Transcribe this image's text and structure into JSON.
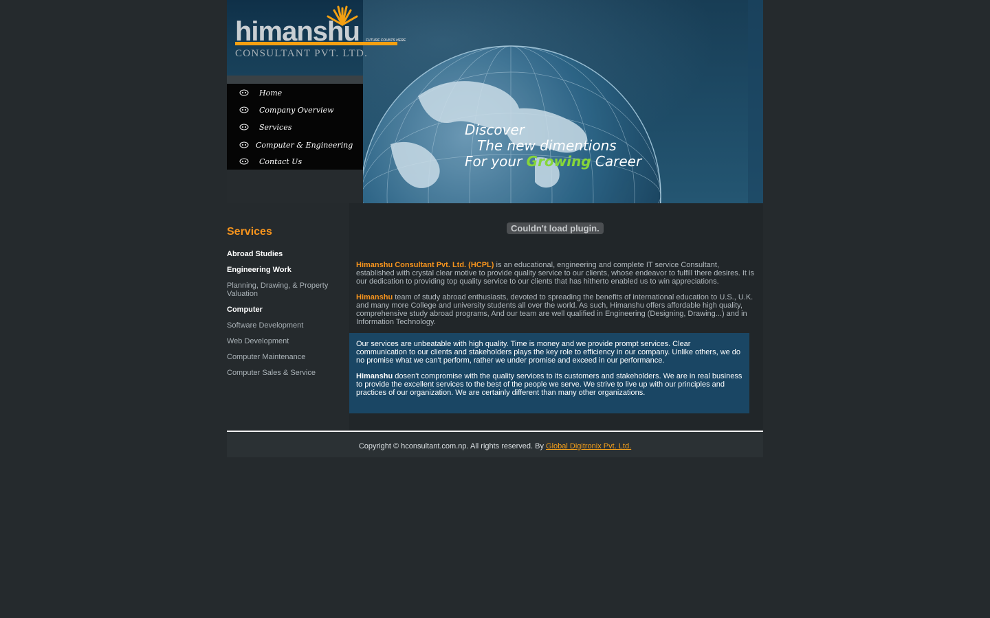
{
  "logo": {
    "name": "himanshu",
    "tagline": "FUTURE COUNTS HERE",
    "subtitle": "CONSULTANT PVT. LTD."
  },
  "banner": {
    "line1": "Discover",
    "line2": "The new dimentions",
    "line3_prefix": "For your",
    "line3_growing": "Growing",
    "line3_career": "Career"
  },
  "nav": {
    "items": [
      {
        "label": "Home"
      },
      {
        "label": "Company Overview"
      },
      {
        "label": "Services"
      },
      {
        "label": "Computer & Engineering"
      },
      {
        "label": "Contact Us"
      }
    ]
  },
  "sidebar": {
    "title": "Services",
    "links": [
      {
        "label": "Abroad Studies",
        "kind": "head"
      },
      {
        "label": "Engineering Work",
        "kind": "head"
      },
      {
        "label": "Planning, Drawing, & Property Valuation",
        "kind": "sub"
      },
      {
        "label": "Computer",
        "kind": "head"
      },
      {
        "label": "Software Development",
        "kind": "sub"
      },
      {
        "label": "Web Development",
        "kind": "sub"
      },
      {
        "label": "Computer Maintenance",
        "kind": "sub"
      },
      {
        "label": "Computer Sales & Service",
        "kind": "sub"
      }
    ]
  },
  "main": {
    "plugin_message": "Couldn't load plugin.",
    "para1_highlight": "Himanshu Consultant Pvt. Ltd. (HCPL)",
    "para1_text": " is an educational, engineering and complete IT service Consultant, established with crystal clear motive to provide quality service to our clients, whose endeavor to fulfill there desires. It is our dedication to providing top quality service to our clients that has hitherto enabled us to win appreciations.",
    "para2_highlight": "Himanshu",
    "para2_text": " team of study abroad enthusiasts, devoted to spreading the benefits of international education to U.S., U.K. and many more College and university students all over the world. As such, Himanshu offers affordable high quality, comprehensive study abroad programs, And our team are well qualified in Engineering (Designing, Drawing...) and in Information Technology.",
    "box_para1": "Our services are unbeatable with high quality. Time is money and we provide prompt services. Clear communication to our clients and stakeholders plays the key role to efficiency in our company. Unlike others, we do no promise what we can't perform, rather we under promise and exceed in our performance.",
    "box_para2_bold": "Himanshu",
    "box_para2_text": " dosen't compromise with the quality services to its customers and stakeholders. We are in real business to provide the excellent services to the best of the people we serve. We strive to live up with our principles and practices of our organization. We are certainly different than many other organizations."
  },
  "footer": {
    "copyright": "Copyright © hconsultant.com.np. All rights reserved. By ",
    "link_label": "Global Digitronix Pvt. Ltd."
  },
  "colors": {
    "background": "#252a2d",
    "accent_orange": "#f7941d",
    "accent_green": "#86d63a",
    "box_blue": "#1a4664"
  }
}
